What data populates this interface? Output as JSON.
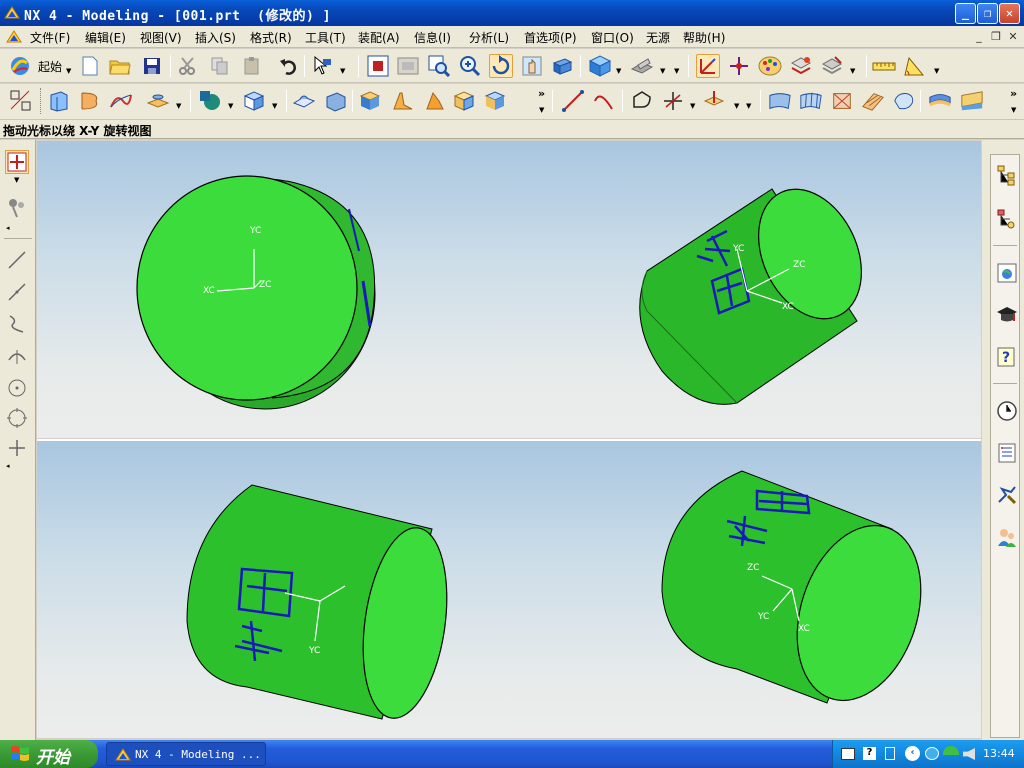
{
  "window": {
    "title": "NX 4 - Modeling - [001.prt  (修改的) ]",
    "min_label": "_",
    "max_label": "❐",
    "close_label": "✕"
  },
  "menu": {
    "items": [
      "文件(F)",
      "编辑(E)",
      "视图(V)",
      "插入(S)",
      "格式(R)",
      "工具(T)",
      "装配(A)",
      "信息(I)",
      "分析(L)",
      "首选项(P)",
      "窗口(O)",
      "无源",
      "帮助(H)"
    ],
    "mdi_min": "_",
    "mdi_restore": "❐",
    "mdi_close": "✕"
  },
  "toolbar": {
    "start_label": "起始",
    "overflow": "»"
  },
  "hint": {
    "text": "拖动光标以绕 X-Y 旋转视图"
  },
  "viewports": [
    {
      "labels": [
        "YC",
        "XC",
        "ZC"
      ]
    },
    {
      "labels": [
        "YC",
        "ZC",
        "XC"
      ]
    },
    {
      "labels": [
        "YC"
      ]
    },
    {
      "labels": [
        "ZC",
        "YC",
        "XC"
      ]
    }
  ],
  "colors": {
    "body": "#3cdc3c",
    "body_dark": "#1e8a1e",
    "engrave": "#1a1ab8",
    "axis": "#ffffff",
    "sky_top": "#a9c6e0",
    "sky_bottom": "#ececec"
  },
  "taskbar": {
    "start": "开始",
    "task": "NX 4 - Modeling ...",
    "time": "13:44"
  }
}
